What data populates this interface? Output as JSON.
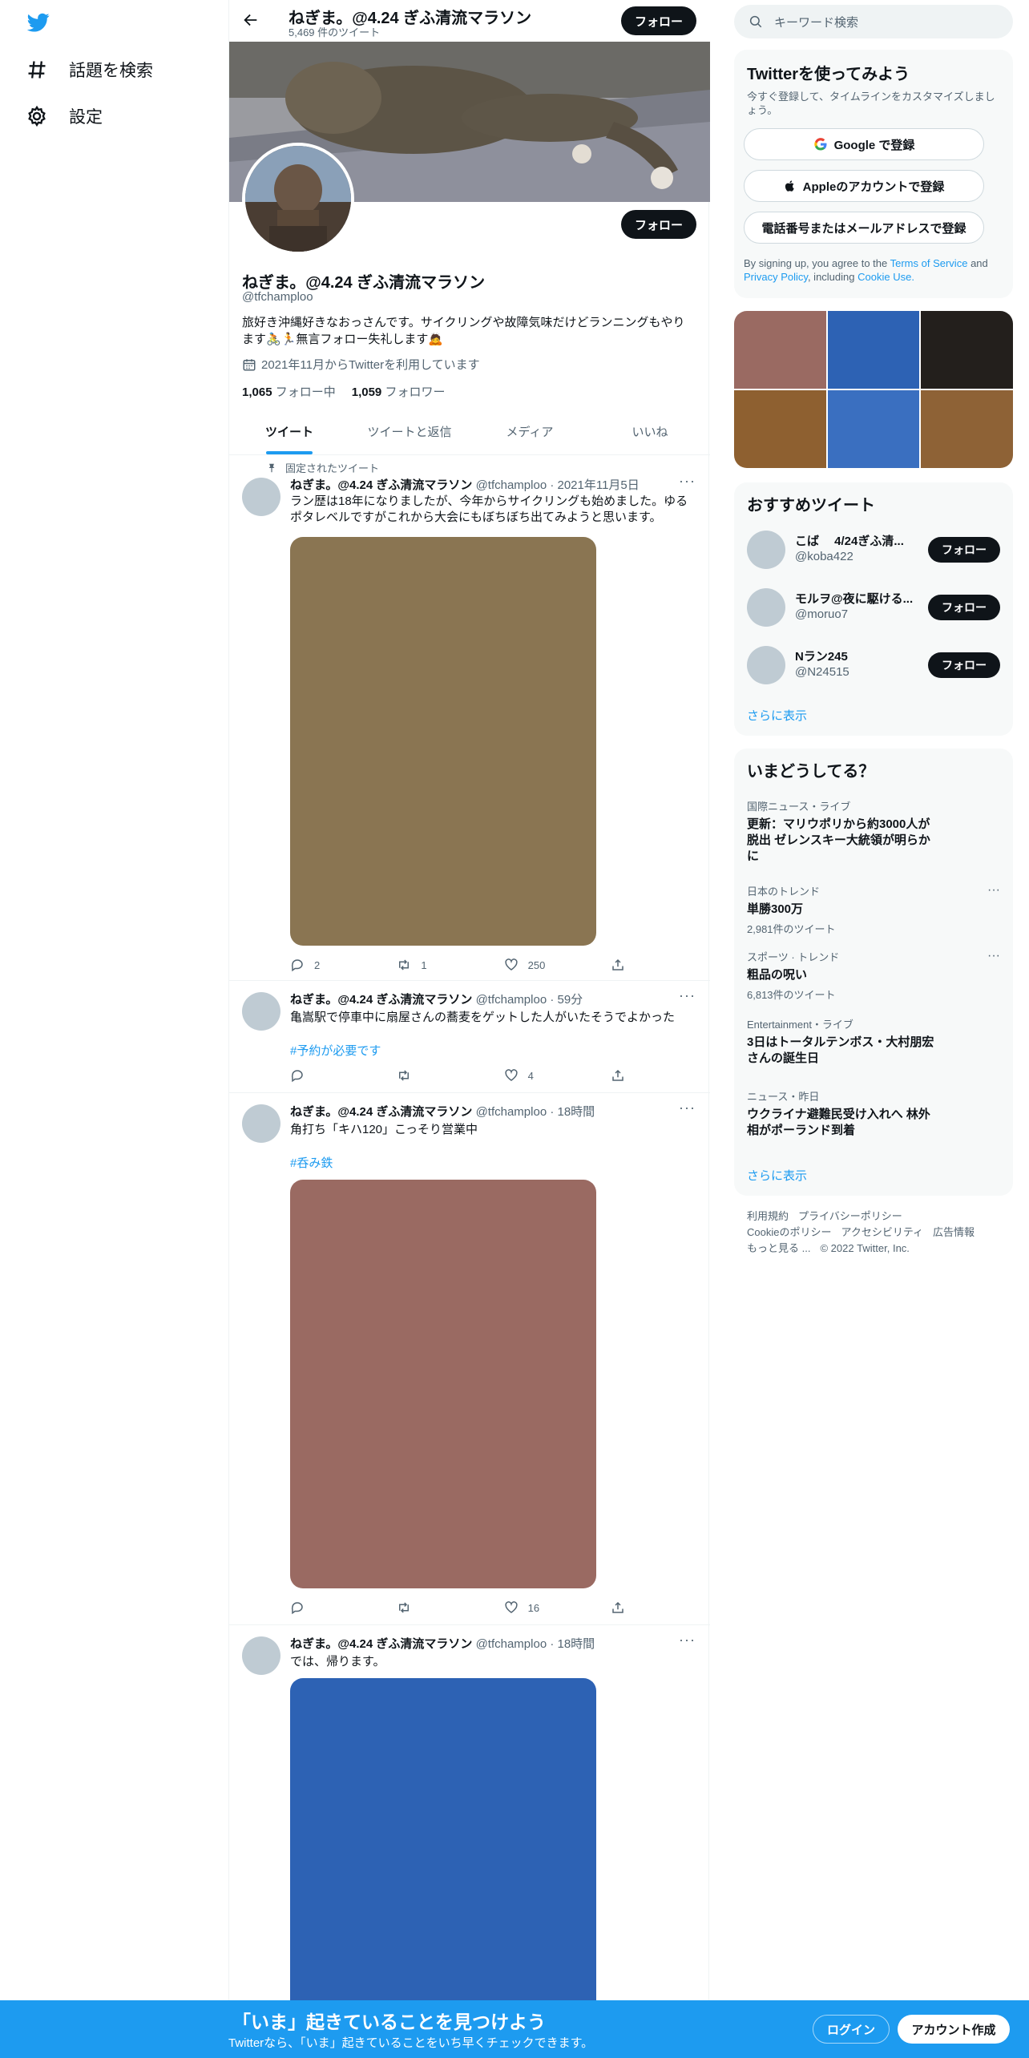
{
  "nav": {
    "explore_label": "話題を検索",
    "settings_label": "設定"
  },
  "header": {
    "name": "ねぎま。@4.24 ぎふ清流マラソン",
    "tweet_count": "5,469 件のツイート",
    "follow_label": "フォロー"
  },
  "profile": {
    "name": "ねぎま。@4.24 ぎふ清流マラソン",
    "handle": "@tfchamploo",
    "bio_line1": "旅好き沖縄好きなおっさんです。サイクリングや故障気味だけどランニングもやり",
    "bio_line2": "ます🚴🏃無言フォロー失礼します🙇",
    "joined": "2021年11月からTwitterを利用しています",
    "following_count": "1,065",
    "following_label": "フォロー中",
    "followers_count": "1,059",
    "followers_label": "フォロワー",
    "follow_label": "フォロー"
  },
  "tabs": [
    {
      "label": "ツイート",
      "active": true
    },
    {
      "label": "ツイートと返信",
      "active": false
    },
    {
      "label": "メディア",
      "active": false
    },
    {
      "label": "いいね",
      "active": false
    }
  ],
  "tweets": [
    {
      "pinned_label": "固定されたツイート",
      "name": "ねぎま。@4.24 ぎふ清流マラソン",
      "meta": "@tfchamploo · 2021年11月5日",
      "text": "ラン歴は18年になりましたが、今年からサイクリングも始めました。ゆるポタレベルですがこれから大会にもぼちぼち出てみようと思います。",
      "media_color": "#8a7552",
      "replies": "2",
      "retweets": "1",
      "likes": "250"
    },
    {
      "name": "ねぎま。@4.24 ぎふ清流マラソン",
      "meta": "@tfchamploo · 59分",
      "text": "亀嵩駅で停車中に扇屋さんの蕎麦をゲットした人がいたそうでよかった",
      "hashtag": "#予約が必要です",
      "replies": "",
      "retweets": "",
      "likes": "4"
    },
    {
      "name": "ねぎま。@4.24 ぎふ清流マラソン",
      "meta": "@tfchamploo · 18時間",
      "text": "角打ち「キハ120」こっそり営業中",
      "hashtag": "#呑み鉄",
      "media_color": "#9a6a62",
      "replies": "",
      "retweets": "",
      "likes": "16"
    },
    {
      "name": "ねぎま。@4.24 ぎふ清流マラソン",
      "meta": "@tfchamploo · 18時間",
      "text": "では、帰ります。",
      "media_color": "#2d62b4"
    }
  ],
  "search": {
    "placeholder": "キーワード検索"
  },
  "signup": {
    "title": "Twitterを使ってみよう",
    "subtitle": "今すぐ登録して、タイムラインをカスタマイズしましょう。",
    "google_label": "Google で登録",
    "apple_label": "Appleのアカウントで登録",
    "phone_label": "電話番号またはメールアドレスで登録",
    "terms_pre": "By signing up, you agree to the",
    "terms_link": "Terms of Service",
    "terms_and": "and",
    "privacy_link": "Privacy Policy",
    "including": ", including",
    "cookie_link": "Cookie Use."
  },
  "media_grid_colors": [
    "#9a6a62",
    "#2d62b4",
    "#231f1c",
    "#8e6030",
    "#3a6fc0",
    "#8e6236"
  ],
  "recommended": {
    "title": "おすすめツイート",
    "users": [
      {
        "name": "こば　 4/24ぎふ清...",
        "handle": "@koba422",
        "follow": "フォロー"
      },
      {
        "name": "モルヲ@夜に駆ける...",
        "handle": "@moruo7",
        "follow": "フォロー"
      },
      {
        "name": "Nラン245",
        "handle": "@N24515",
        "follow": "フォロー"
      }
    ],
    "show_more": "さらに表示"
  },
  "trends": {
    "title": "いまどうしてる？",
    "items": [
      {
        "context": "国際ニュース・ライブ",
        "title": "更新：マリウポリから約3000人が脱出 ゼレンスキー大統領が明らかに",
        "count": ""
      },
      {
        "context": "日本のトレンド",
        "title": "単勝300万",
        "count": "2,981件のツイート"
      },
      {
        "context": "スポーツ · トレンド",
        "title": "粗品の呪い",
        "count": "6,813件のツイート"
      },
      {
        "context": "Entertainment・ライブ",
        "title": "3日はトータルテンボス・大村朋宏さんの誕生日",
        "count": ""
      },
      {
        "context": "ニュース・昨日",
        "title": "ウクライナ避難民受け入れへ 林外相がポーランド到着",
        "count": ""
      }
    ],
    "show_more": "さらに表示"
  },
  "footer": {
    "terms": "利用規約",
    "privacy": "プライバシーポリシー",
    "cookie": "Cookieのポリシー",
    "accessibility": "アクセシビリティ",
    "ads": "広告情報",
    "more": "もっと見る ...",
    "copyright": "© 2022 Twitter, Inc."
  },
  "bottom_bar": {
    "headline": "「いま」起きていることを見つけよう",
    "sub": "Twitterなら、「いま」起きていることをいち早くチェックできます。",
    "login": "ログイン",
    "signup": "アカウント作成"
  },
  "colors": {
    "accent": "#1d9bf0",
    "black_button": "#0f1419"
  }
}
